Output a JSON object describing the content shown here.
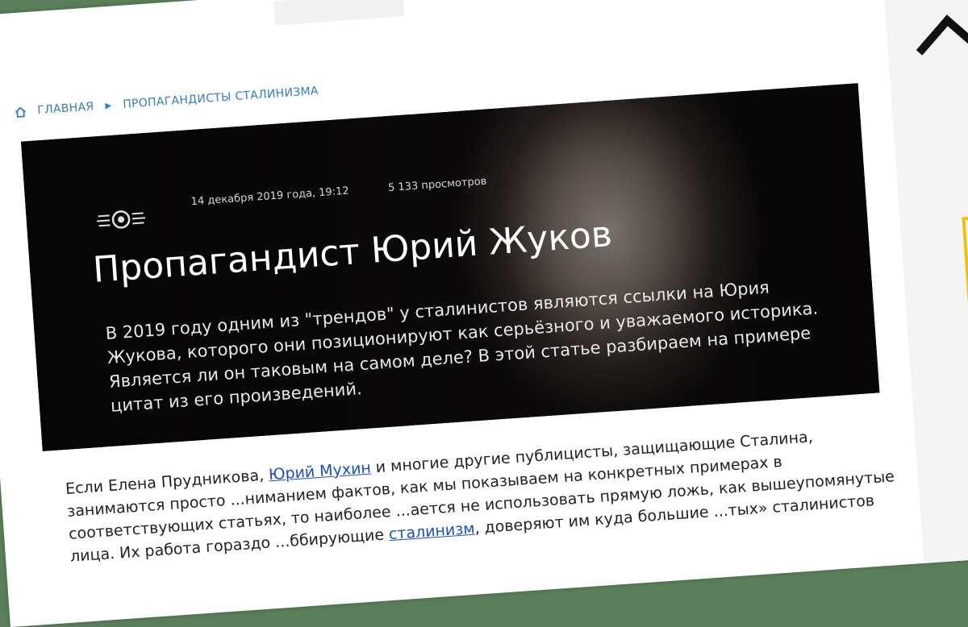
{
  "breadcrumb": {
    "home_icon": "home-icon",
    "items": [
      "ГЛАВНАЯ",
      "ПРОПАГАНДИСТЫ СТАЛИНИЗМА"
    ]
  },
  "article": {
    "date": "14 декабря 2019 года, 19:12",
    "views": "5 133 просмотров",
    "title": "Пропагандист Юрий Жуков",
    "lead": "В 2019 году одним из \"трендов\" у сталинистов являются ссылки на Юрия Жукова, которого они позиционируют как серьёзного и уважаемого историка. Является ли он таковым на самом деле? В этой статье разбираем на примере цитат из его произведений.",
    "body": {
      "part1": "Если Елена Прудникова, ",
      "link1": "Юрий Мухин",
      "part2": " и многие другие публицисты, защищающие Сталина, занимаются просто ...ниманием фактов, как мы показываем на конкретных примерах в соответствующих статьях, то наиболее ...ается не использовать прямую ложь, как вышеупомянутые лица. Их работа гораздо ...ббирующие ",
      "link2": "сталинизм",
      "part3": ", доверяют им куда большие ...тых» сталинистов"
    }
  },
  "colors": {
    "link": "#2f7cc8",
    "background": "#5b7f5a",
    "accent": "#f2c100"
  },
  "icons": {
    "scroll_top": "chevron-up-icon",
    "logo": "site-logo-icon"
  }
}
